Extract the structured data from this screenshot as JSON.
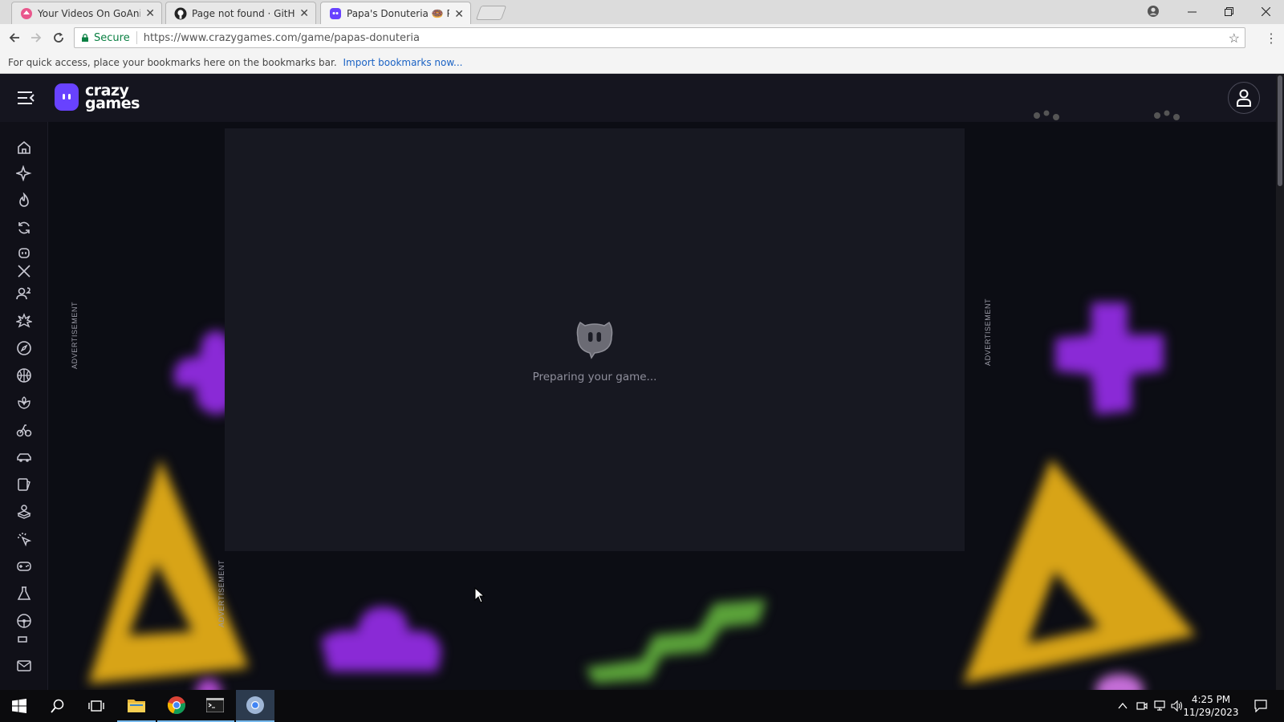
{
  "browser": {
    "tabs": [
      {
        "title": "Your Videos On GoAnima",
        "active": false
      },
      {
        "title": "Page not found · GitHub",
        "active": false
      },
      {
        "title": "Papa's Donuteria 🍩 Play",
        "active": true
      }
    ],
    "address_bar": {
      "secure_label": "Secure",
      "url": "https://www.crazygames.com/game/papas-donuteria"
    },
    "bookmarks_bar": {
      "message": "For quick access, place your bookmarks here on the bookmarks bar.",
      "link": "Import bookmarks now..."
    }
  },
  "site": {
    "logo": {
      "line1": "crazy",
      "line2": "games"
    },
    "sidebar_icons": [
      "home-icon",
      "new-icon",
      "trending-icon",
      "updated-icon",
      "originals-icon",
      "two-player-icon",
      "action-icon",
      "adventure-icon",
      "basketball-icon",
      "beauty-icon",
      "bike-icon",
      "car-icon",
      "card-icon",
      "casual-icon",
      "clicker-icon",
      "controller-icon",
      "driving-icon",
      "steering-icon",
      "contact-icon"
    ],
    "ad_label": "ADVERTISEMENT",
    "game_loader": {
      "message": "Preparing your game..."
    }
  },
  "taskbar": {
    "time": "4:25 PM",
    "date": "11/29/2023"
  },
  "colors": {
    "brand_purple": "#6842ff",
    "page_bg": "#0c0d14",
    "header_bg": "#15151f"
  }
}
